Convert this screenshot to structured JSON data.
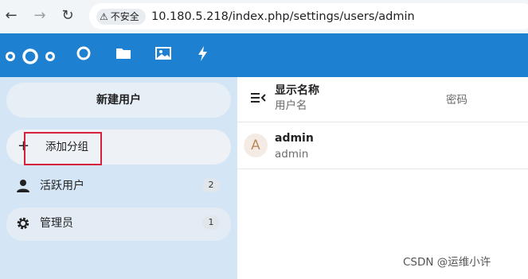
{
  "browser": {
    "security_label": "不安全",
    "url": "10.180.5.218/index.php/settings/users/admin"
  },
  "sidebar": {
    "new_user_label": "新建用户",
    "add_group_label": "添加分组",
    "items": [
      {
        "label": "活跃用户",
        "count": "2"
      },
      {
        "label": "管理员",
        "count": "1"
      }
    ]
  },
  "table": {
    "header": {
      "display_name": "显示名称",
      "username": "用户名",
      "password": "密码"
    },
    "rows": [
      {
        "avatar_initial": "A",
        "display_name": "admin",
        "username": "admin"
      }
    ]
  },
  "watermark": "CSDN @运维小许",
  "colors": {
    "header_blue": "#1d80d1",
    "sidebar_bg": "#d4e6f5",
    "highlight_box": "#d6203c"
  },
  "icons": [
    "back-icon",
    "forward-icon",
    "reload-icon",
    "warning-icon",
    "nextcloud-logo",
    "dashboard-icon",
    "files-icon",
    "photos-icon",
    "activity-icon",
    "plus-icon",
    "user-icon",
    "gear-icon",
    "sidebar-toggle-icon"
  ]
}
